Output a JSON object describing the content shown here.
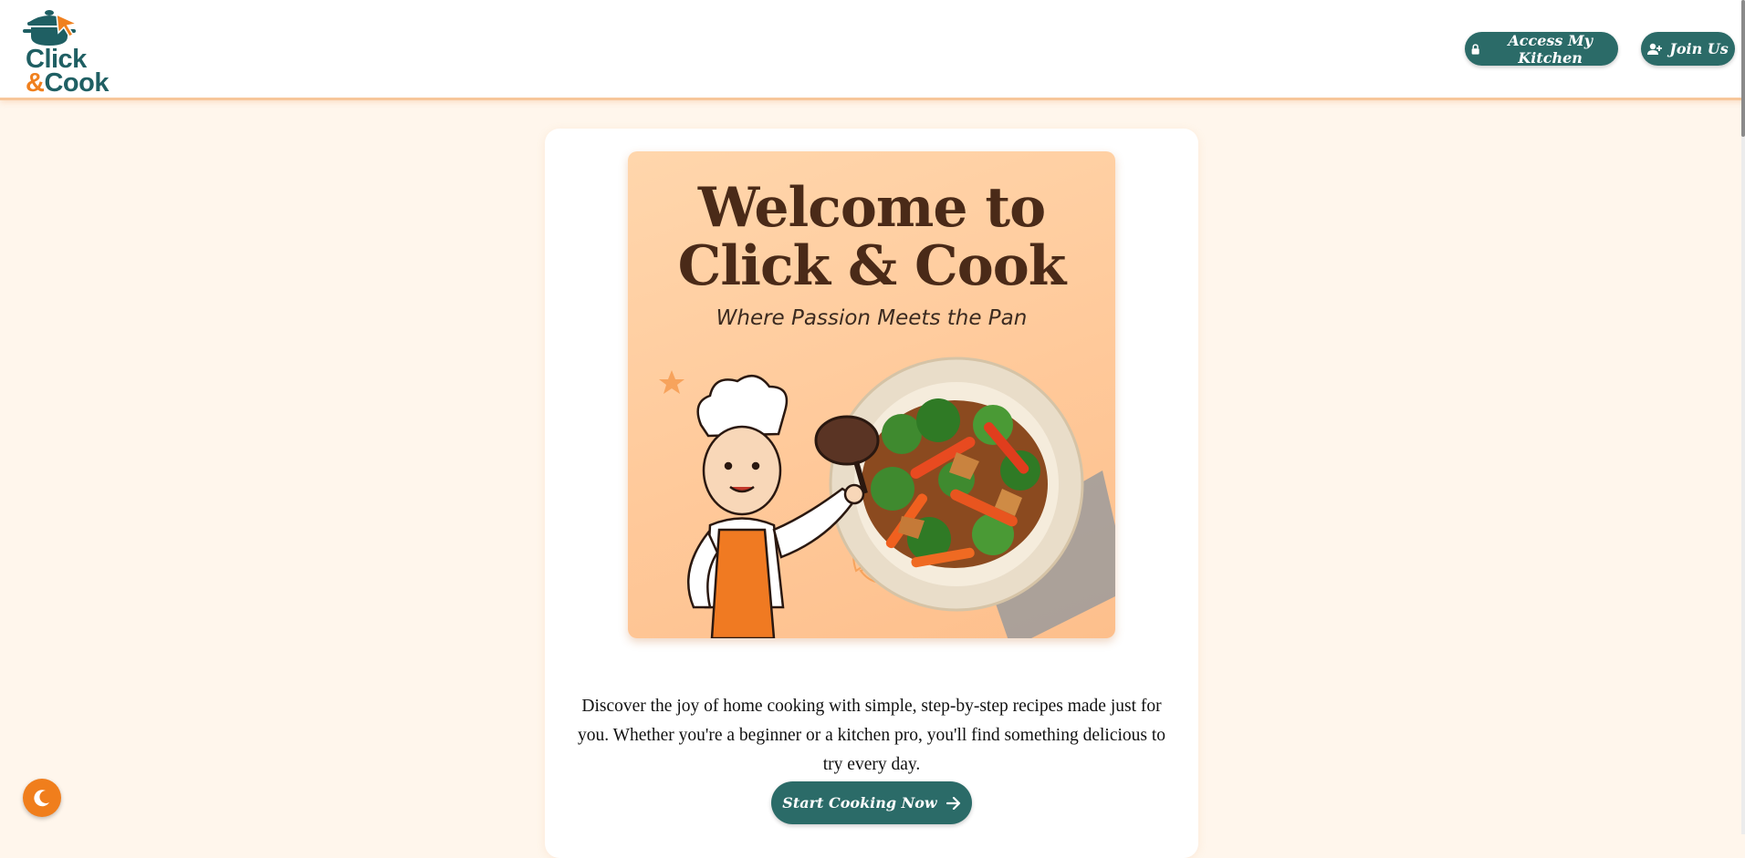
{
  "header": {
    "logo": {
      "line1": "Click",
      "amp": "&",
      "line2": "Cook"
    },
    "login_label": "Access My Kitchen",
    "join_label": "Join Us",
    "login_icon": "lock-icon",
    "join_icon": "user-plus-icon"
  },
  "hero": {
    "title": "Welcome to\nClick & Cook",
    "subtitle": "Where Passion Meets the Pan"
  },
  "intro": {
    "description": "Discover the joy of home cooking with simple, step-by-step recipes made just for you. Whether you're a beginner or a kitchen pro, you'll find something delicious to try every day.",
    "cta_label": "Start Cooking Now",
    "cta_icon": "arrow-right-icon"
  },
  "theme_toggle": {
    "icon": "moon-icon"
  },
  "colors": {
    "brand_teal": "#2b6b68",
    "accent_orange": "#f07e1c",
    "page_background": "#fff6ec",
    "hero_peach": "#ffc99a"
  }
}
